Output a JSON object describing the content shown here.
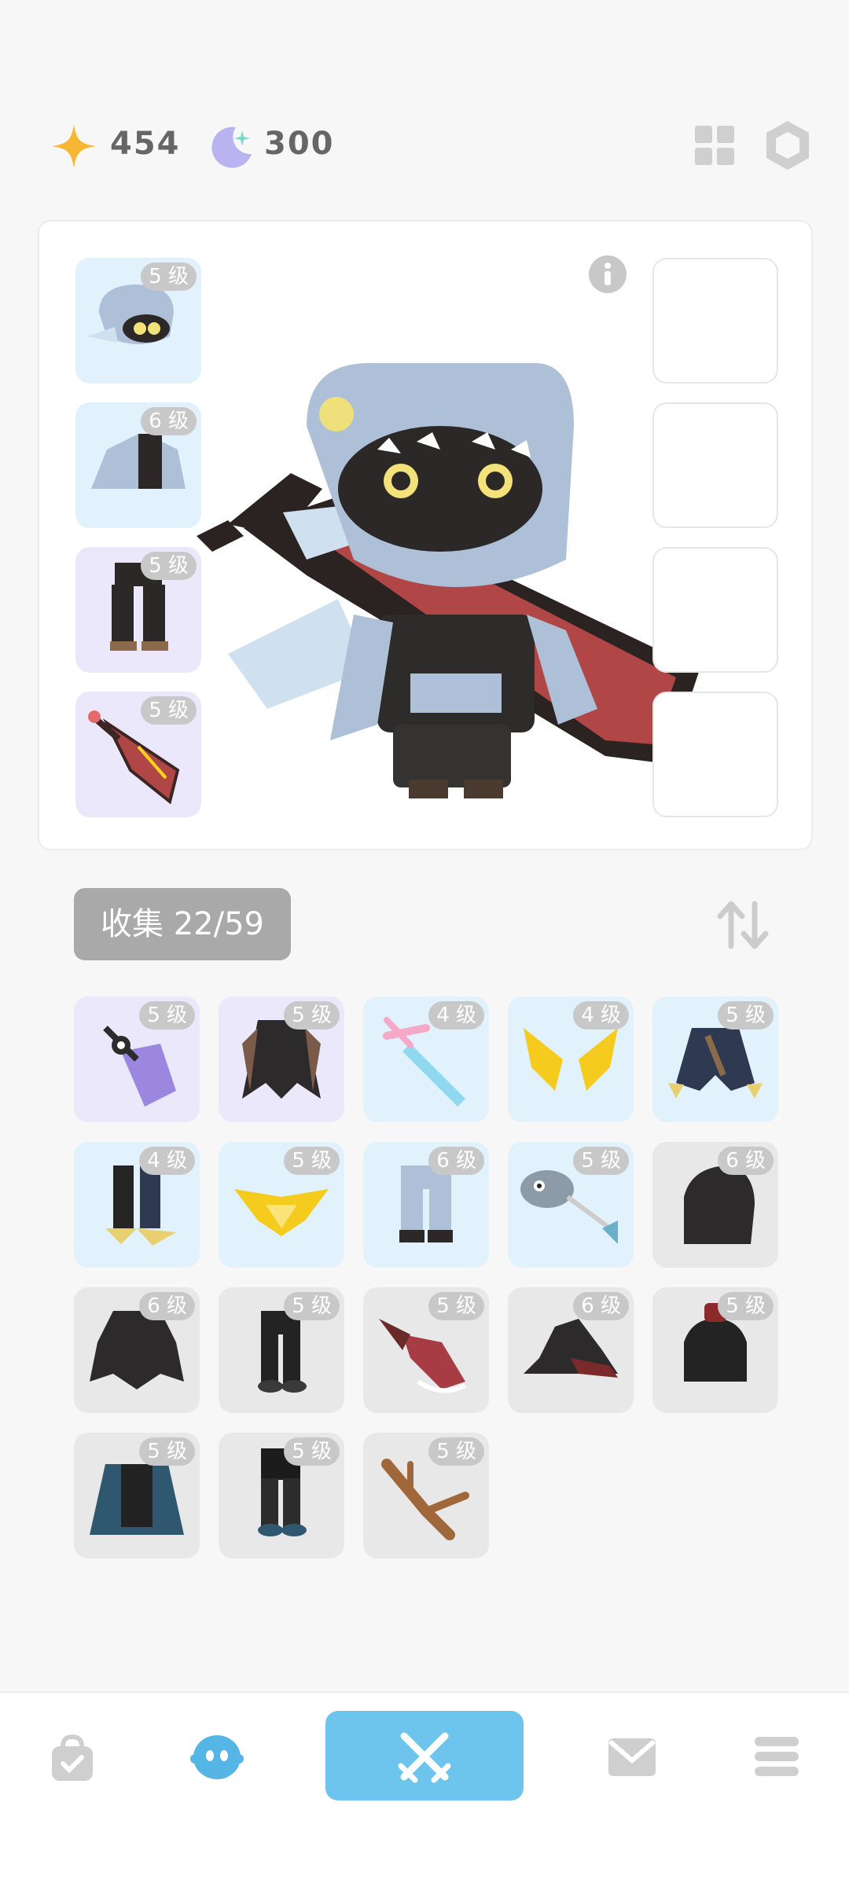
{
  "currency": {
    "stars": "454",
    "moons": "300"
  },
  "equipped": [
    {
      "name": "helmet",
      "level": "5 级"
    },
    {
      "name": "wings",
      "level": "6 级"
    },
    {
      "name": "pants",
      "level": "5 级"
    },
    {
      "name": "sword",
      "level": "5 级"
    }
  ],
  "collection": {
    "label": "收集 22/59"
  },
  "items": [
    {
      "level": "5 级",
      "bg": "purple",
      "icon": "crystal-weapon-icon"
    },
    {
      "level": "5 级",
      "bg": "purple",
      "icon": "dark-cloak-icon"
    },
    {
      "level": "4 级",
      "bg": "blue",
      "icon": "pink-sword-icon"
    },
    {
      "level": "4 级",
      "bg": "blue",
      "icon": "golden-wings-icon"
    },
    {
      "level": "5 级",
      "bg": "blue",
      "icon": "claw-armor-icon"
    },
    {
      "level": "4 级",
      "bg": "blue",
      "icon": "claw-boots-icon"
    },
    {
      "level": "5 级",
      "bg": "blue",
      "icon": "golden-crest-icon"
    },
    {
      "level": "6 级",
      "bg": "blue",
      "icon": "blue-legs-icon"
    },
    {
      "level": "5 级",
      "bg": "blue",
      "icon": "fish-bone-icon"
    },
    {
      "level": "6 级",
      "bg": "gray",
      "icon": "black-hood-icon"
    },
    {
      "level": "6 级",
      "bg": "gray",
      "icon": "spiked-armor-icon"
    },
    {
      "level": "5 级",
      "bg": "gray",
      "icon": "black-boots-icon"
    },
    {
      "level": "5 级",
      "bg": "gray",
      "icon": "red-blade-icon"
    },
    {
      "level": "6 级",
      "bg": "gray",
      "icon": "witch-hat-icon"
    },
    {
      "level": "5 级",
      "bg": "gray",
      "icon": "dark-robe-icon"
    },
    {
      "level": "5 级",
      "bg": "gray",
      "icon": "blue-cape-icon"
    },
    {
      "level": "5 级",
      "bg": "gray",
      "icon": "dark-boots-icon"
    },
    {
      "level": "5 级",
      "bg": "gray",
      "icon": "wooden-branch-icon"
    }
  ],
  "colors": {
    "accent": "#6dc5ee",
    "slot_blue": "#e1f2fc",
    "slot_purple": "#ece8fb",
    "slot_gray": "#e8e8e8"
  }
}
